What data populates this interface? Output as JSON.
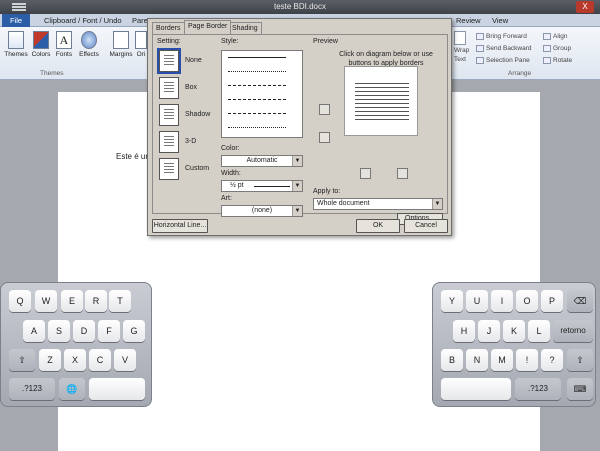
{
  "window": {
    "title": "teste BDI.docx",
    "close_label": "X"
  },
  "ribbon": {
    "tabs": [
      "File",
      "Clipboard / Font / Undo",
      "Pare",
      "Review",
      "View"
    ],
    "buttons": [
      "Themes",
      "Colors",
      "Fonts",
      "Effects",
      "Margins",
      "Ori"
    ],
    "groups": [
      "Themes",
      "Arrange"
    ],
    "arrange": {
      "wrap": "Wrap",
      "text": "Text",
      "bring_forward": "Bring Forward",
      "send_backward": "Send Backward",
      "selection_pane": "Selection Pane",
      "align": "Align",
      "group": "Group",
      "rotate": "Rotate"
    }
  },
  "document": {
    "text": "Este é um"
  },
  "dialog": {
    "tabs": [
      "Borders",
      "Page Border",
      "Shading"
    ],
    "setting_label": "Setting:",
    "settings": [
      "None",
      "Box",
      "Shadow",
      "3-D",
      "Custom"
    ],
    "style_label": "Style:",
    "color_label": "Color:",
    "color_value": "Automatic",
    "width_label": "Width:",
    "width_value": "½ pt",
    "art_label": "Art:",
    "art_value": "(none)",
    "preview_label": "Preview",
    "preview_hint": "Click on diagram below or use buttons to apply borders",
    "apply_to_label": "Apply to:",
    "apply_to_value": "Whole document",
    "options_button": "Options...",
    "horizontal_line_button": "Horizontal Line...",
    "ok_button": "OK",
    "cancel_button": "Cancel"
  },
  "keyboard_left": {
    "row1": [
      "Q",
      "W",
      "E",
      "R",
      "T"
    ],
    "row2": [
      "A",
      "S",
      "D",
      "F",
      "G"
    ],
    "row3": [
      "⇧",
      "Z",
      "X",
      "C",
      "V"
    ],
    "row4": [
      ".?123",
      "🌐",
      ""
    ]
  },
  "keyboard_right": {
    "row1": [
      "Y",
      "U",
      "I",
      "O",
      "P",
      "⌫"
    ],
    "row2": [
      "H",
      "J",
      "K",
      "L",
      "retorno"
    ],
    "row3": [
      "B",
      "N",
      "M",
      "!",
      "?",
      "⇧"
    ],
    "row4": [
      "",
      ".?123",
      "⌨"
    ]
  }
}
